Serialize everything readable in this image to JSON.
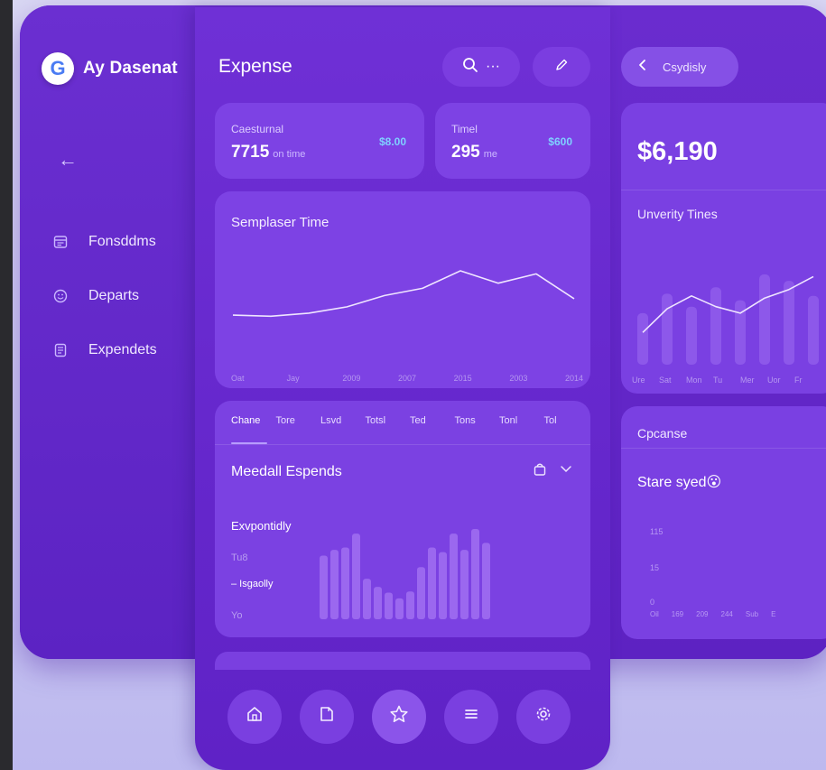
{
  "sidebar": {
    "brand_letter": "G",
    "brand_name": "Ay Dasenat",
    "back_icon": "←",
    "items": [
      {
        "label": "Fonsddms",
        "icon": "calendar-icon"
      },
      {
        "label": "Departs",
        "icon": "emoji-icon"
      },
      {
        "label": "Expendets",
        "icon": "document-icon"
      }
    ]
  },
  "header": {
    "title": "Expense",
    "search_icon": "search-icon",
    "search_more": "···",
    "edit_icon": "pencil-icon"
  },
  "stats": [
    {
      "label": "Caesturnal",
      "value": "7715",
      "unit": "on time",
      "amount": "$8.00"
    },
    {
      "label": "Timel",
      "value": "295",
      "unit": "me",
      "amount": "$600"
    }
  ],
  "line_chart": {
    "title": "Semplaser Time",
    "x_labels": [
      "Oat",
      "Jay",
      "2009",
      "2007",
      "2015",
      "2003",
      "2014"
    ],
    "values": [
      2.0,
      1.9,
      2.2,
      2.8,
      3.9,
      4.6,
      6.3,
      5.1,
      6.0,
      3.6
    ]
  },
  "tabs": {
    "labels": [
      "Chane",
      "Tore",
      "Lsvd",
      "Totsl",
      "Ted",
      "Tons",
      "Tonl",
      "Tol"
    ],
    "active_index": 0
  },
  "spend_section": {
    "title": "Meedall Espends",
    "sub_title": "Exvpontidly",
    "mini_label_1": "Tu8",
    "legend": "– Isgaolly",
    "mini_label_2": "Yo",
    "bars": [
      55,
      60,
      62,
      74,
      35,
      28,
      23,
      18,
      24,
      45,
      62,
      58,
      74,
      60,
      78,
      66
    ]
  },
  "bottom_nav": [
    {
      "icon": "home-icon",
      "active": false
    },
    {
      "icon": "note-icon",
      "active": false
    },
    {
      "icon": "star-icon",
      "active": true
    },
    {
      "icon": "menu-icon",
      "active": false
    },
    {
      "icon": "settings-icon",
      "active": false
    }
  ],
  "right_panel": {
    "back_label": "Csydisly",
    "amount": "$6,190",
    "chart_title": "Unverity Tines",
    "x_labels": [
      "Ure",
      "Sat",
      "Mon",
      "Tu",
      "Mer",
      "Uor",
      "Fr"
    ],
    "bars": [
      48,
      66,
      54,
      72,
      60,
      84,
      78,
      64
    ],
    "line": [
      30,
      52,
      64,
      54,
      48,
      62,
      70,
      82
    ],
    "bottom_title": "Cpcanse",
    "bottom_head": "Stare syed",
    "bottom_emoji": "😮",
    "y_ticks": [
      "115",
      "15",
      "0"
    ],
    "x_ticks": [
      "Oil",
      "169",
      "209",
      "244",
      "Sub",
      "E"
    ]
  },
  "colors": {
    "panel": "#6a2ccf",
    "card": "#7d42e4",
    "line": "#efe5ff",
    "bar": "#9b68ef",
    "amount_accent": "#7fd0ff"
  }
}
